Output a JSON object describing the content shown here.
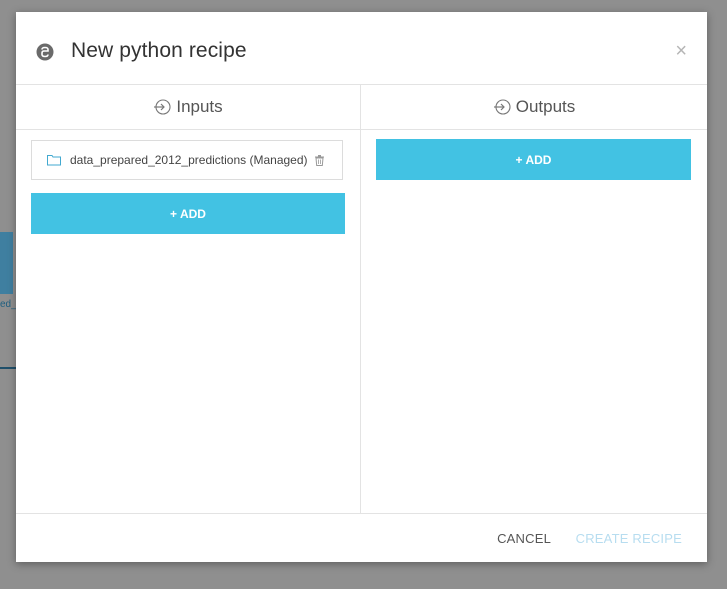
{
  "background": {
    "node_label": "ed_"
  },
  "modal": {
    "title": "New python recipe",
    "close": "×",
    "inputs": {
      "heading": "Inputs",
      "items": [
        {
          "label": "data_prepared_2012_predictions (Managed)"
        }
      ],
      "add_label": "+ ADD"
    },
    "outputs": {
      "heading": "Outputs",
      "add_label": "+ ADD"
    },
    "footer": {
      "cancel_label": "CANCEL",
      "create_label": "CREATE RECIPE"
    }
  },
  "colors": {
    "accent": "#42c2e3",
    "disabled_text": "#b7ddf0",
    "text": "#333333"
  }
}
